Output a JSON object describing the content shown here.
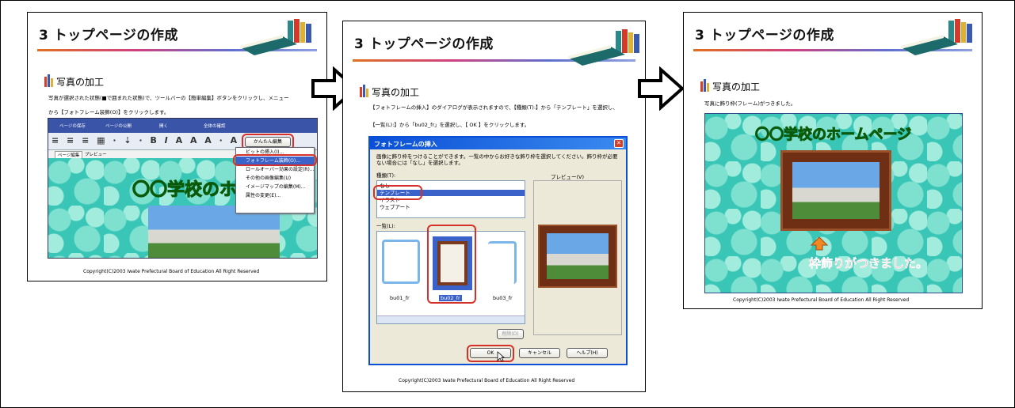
{
  "slides": [
    {
      "title": "3 トップページの作成",
      "section": "写真の加工",
      "instruction_1": "写真が選択された状態(■で囲まれた状態)で、ツールバーの【簡単編集】ボタンをクリックし、メニュー",
      "instruction_2": "から【フォトフレーム装飾(O)】をクリックします。",
      "nav_items": [
        "ページの保存",
        "ページの公開",
        "開く",
        "全体の確認"
      ],
      "kantan_button": "かんたん編集",
      "menu_items": [
        "ビットの挿入(I)...",
        "フォトフレーム装飾(O)...",
        "ロールオーバー効果の設定(R)...",
        "その他の画像編集(U)",
        "イメージマップの編集(M)...",
        "属性の変更(E)..."
      ],
      "tabs": [
        "ページ編集",
        "プレビュー"
      ],
      "school_title": "〇〇学校のホ",
      "copyright": "Copyright(C)2003 Iwate Prefectural Board of Education All Right Reserved"
    },
    {
      "title": "3 トップページの作成",
      "section": "写真の加工",
      "instruction_1": "【フォトフレームの挿入】のダイアログが表示されますので、【種類(T):】から「テンプレート」を選択し、",
      "instruction_2": "【一覧(L):】から「bu02_fr」を選択し、【 OK 】をクリックします。",
      "dialog_title": "フォトフレームの挿入",
      "dialog_desc": "画像に飾り枠をつけることができます。一覧の中からお好きな飾り枠を選択してください。飾り枠が必要ない場合には「なし」を選択します。",
      "kind_label": "種類(T):",
      "kind_options": [
        "なし",
        "テンプレート",
        "イラスト",
        "ウェブアート"
      ],
      "preview_label": "プレビュー(V)",
      "list_label": "一覧(L):",
      "frames": [
        "bu01_fr",
        "bu02_fr",
        "bu03_fr"
      ],
      "delete_button": "削除(D)",
      "ok_button": "OK",
      "cancel_button": "キャンセル",
      "help_button": "ヘルプ(H)",
      "copyright": "Copyright(C)2003 Iwate Prefectural Board of Education All Right Reserved"
    },
    {
      "title": "3 トップページの作成",
      "section": "写真の加工",
      "instruction_1": "写真に飾り枠(フレーム)がつきました。",
      "school_title": "〇〇学校のホームページ",
      "caption": "枠飾りがつきました。",
      "copyright": "Copyright(C)2003 Iwate Prefectural Board of Education All Right Reserved"
    }
  ],
  "colors": {
    "caption_red": "#e8202a",
    "school_green": "#2ad12a",
    "teal_bg": "#39c6b7",
    "frame_brown": "#7a3a1e"
  }
}
